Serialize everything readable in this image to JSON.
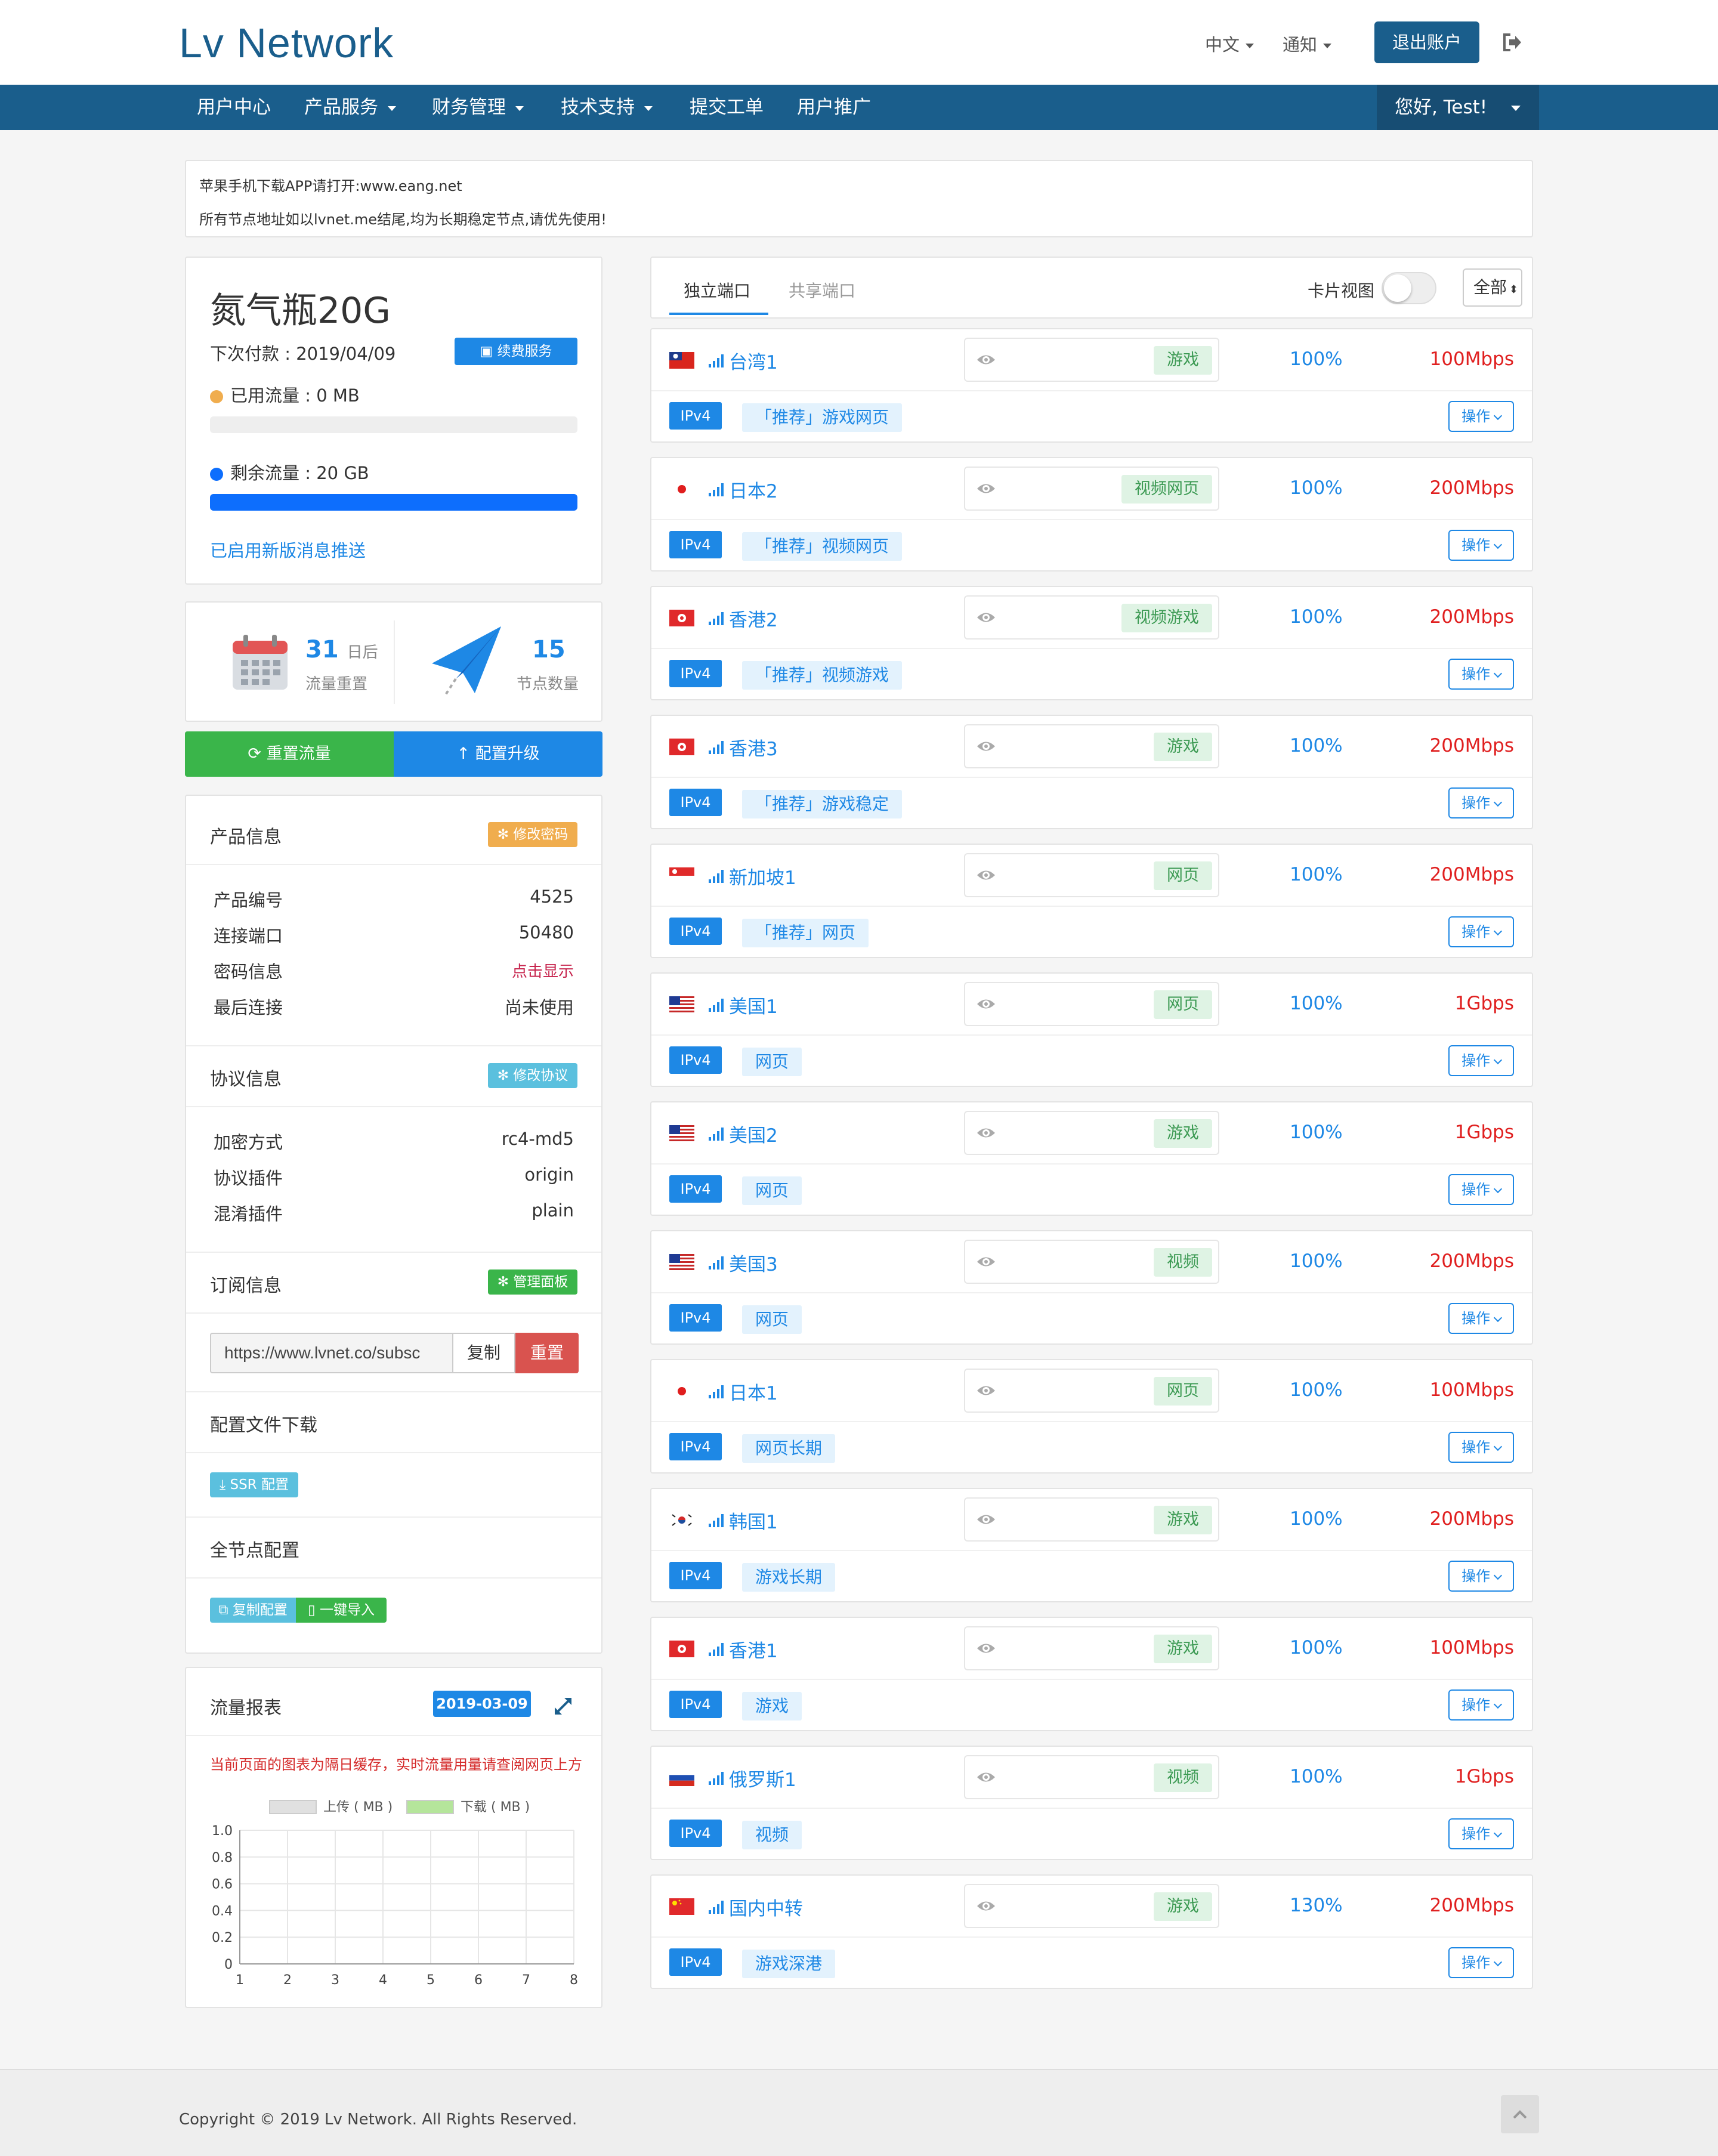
{
  "header": {
    "logo": "Lv Network",
    "lang_label": "中文",
    "notify_label": "通知",
    "logout_label": "退出账户"
  },
  "nav": {
    "items": [
      {
        "label": "用户中心",
        "dropdown": false
      },
      {
        "label": "产品服务",
        "dropdown": true
      },
      {
        "label": "财务管理",
        "dropdown": true
      },
      {
        "label": "技术支持",
        "dropdown": true
      },
      {
        "label": "提交工单",
        "dropdown": false
      },
      {
        "label": "用户推广",
        "dropdown": false
      }
    ],
    "user_label": "您好, Test!"
  },
  "notice": {
    "line1": "苹果手机下载APP请打开:www.eang.net",
    "line2": "所有节点地址如以lvnet.me结尾,均为长期稳定节点,请优先使用!"
  },
  "plan": {
    "name": "氮气瓶20G",
    "next_payment": "下次付款 : 2019/04/09",
    "renew_label": "续费服务",
    "used_label": "已用流量 : 0 MB",
    "remaining_label": "剩余流量 : 20 GB",
    "used_fraction": 0,
    "remaining_fraction": 1,
    "push_link": "已启用新版消息推送"
  },
  "stats": {
    "reset_days": "31",
    "reset_days_unit": "日后",
    "reset_caption": "流量重置",
    "node_count": "15",
    "node_caption": "节点数量"
  },
  "actions": {
    "reset_traffic": "重置流量",
    "upgrade": "配置升级"
  },
  "product_info": {
    "title": "产品信息",
    "change_pwd_label": "修改密码",
    "rows": [
      {
        "label": "产品编号",
        "value": "4525"
      },
      {
        "label": "连接端口",
        "value": "50480"
      },
      {
        "label": "密码信息",
        "value": "点击显示"
      },
      {
        "label": "最后连接",
        "value": "尚未使用"
      }
    ]
  },
  "protocol_info": {
    "title": "协议信息",
    "change_label": "修改协议",
    "rows": [
      {
        "label": "加密方式",
        "value": "rc4-md5"
      },
      {
        "label": "协议插件",
        "value": "origin"
      },
      {
        "label": "混淆插件",
        "value": "plain"
      }
    ]
  },
  "subscription": {
    "title": "订阅信息",
    "manage_label": "管理面板",
    "url_value": "https://www.lvnet.co/subsc",
    "copy_label": "复制",
    "reset_label": "重置"
  },
  "config_download": {
    "title": "配置文件下载",
    "ssr_label": "SSR 配置"
  },
  "all_nodes": {
    "title": "全节点配置",
    "copy_label": "复制配置",
    "import_label": "一键导入"
  },
  "traffic_report": {
    "title": "流量报表",
    "date": "2019-03-09",
    "note": "当前页面的图表为隔日缓存，实时流量用量请查阅网页上方"
  },
  "chart_data": {
    "type": "line",
    "title": "",
    "x": [
      1,
      2,
      3,
      4,
      5,
      6,
      7,
      8
    ],
    "series": [
      {
        "name": "上传 ( MB )",
        "values": [],
        "color": "#e0e0e0"
      },
      {
        "name": "下载 ( MB )",
        "values": [],
        "color": "#b5e59b"
      }
    ],
    "ylim": [
      0,
      1.0
    ],
    "yticks": [
      "1.0",
      "0.8",
      "0.6",
      "0.4",
      "0.2",
      "0"
    ],
    "xticks": [
      "1",
      "2",
      "3",
      "4",
      "5",
      "6",
      "7",
      "8"
    ],
    "grid": true,
    "legend_position": "top"
  },
  "nodes_panel": {
    "tab_dedicated": "独立端口",
    "tab_shared": "共享端口",
    "card_view_label": "卡片视图",
    "filter_label": "全部"
  },
  "nodes": [
    {
      "flag": "tw",
      "name": "台湾1",
      "tag": "游戏",
      "load": "100%",
      "speed": "100Mbps",
      "ip": "IPv4",
      "desc": "「推荐」游戏网页",
      "op": "操作"
    },
    {
      "flag": "jp",
      "name": "日本2",
      "tag": "视频网页",
      "load": "100%",
      "speed": "200Mbps",
      "ip": "IPv4",
      "desc": "「推荐」视频网页",
      "op": "操作"
    },
    {
      "flag": "hk",
      "name": "香港2",
      "tag": "视频游戏",
      "load": "100%",
      "speed": "200Mbps",
      "ip": "IPv4",
      "desc": "「推荐」视频游戏",
      "op": "操作"
    },
    {
      "flag": "hk",
      "name": "香港3",
      "tag": "游戏",
      "load": "100%",
      "speed": "200Mbps",
      "ip": "IPv4",
      "desc": "「推荐」游戏稳定",
      "op": "操作"
    },
    {
      "flag": "sg",
      "name": "新加坡1",
      "tag": "网页",
      "load": "100%",
      "speed": "200Mbps",
      "ip": "IPv4",
      "desc": "「推荐」网页",
      "op": "操作"
    },
    {
      "flag": "us",
      "name": "美国1",
      "tag": "网页",
      "load": "100%",
      "speed": "1Gbps",
      "ip": "IPv4",
      "desc": "网页",
      "op": "操作"
    },
    {
      "flag": "us",
      "name": "美国2",
      "tag": "游戏",
      "load": "100%",
      "speed": "1Gbps",
      "ip": "IPv4",
      "desc": "网页",
      "op": "操作"
    },
    {
      "flag": "us",
      "name": "美国3",
      "tag": "视频",
      "load": "100%",
      "speed": "200Mbps",
      "ip": "IPv4",
      "desc": "网页",
      "op": "操作"
    },
    {
      "flag": "jp",
      "name": "日本1",
      "tag": "网页",
      "load": "100%",
      "speed": "100Mbps",
      "ip": "IPv4",
      "desc": "网页长期",
      "op": "操作"
    },
    {
      "flag": "kr",
      "name": "韩国1",
      "tag": "游戏",
      "load": "100%",
      "speed": "200Mbps",
      "ip": "IPv4",
      "desc": "游戏长期",
      "op": "操作"
    },
    {
      "flag": "hk",
      "name": "香港1",
      "tag": "游戏",
      "load": "100%",
      "speed": "100Mbps",
      "ip": "IPv4",
      "desc": "游戏",
      "op": "操作"
    },
    {
      "flag": "ru",
      "name": "俄罗斯1",
      "tag": "视频",
      "load": "100%",
      "speed": "1Gbps",
      "ip": "IPv4",
      "desc": "视频",
      "op": "操作"
    },
    {
      "flag": "cn",
      "name": "国内中转",
      "tag": "游戏",
      "load": "130%",
      "speed": "200Mbps",
      "ip": "IPv4",
      "desc": "游戏深港",
      "op": "操作"
    }
  ],
  "footer": {
    "copyright": "Copyright © 2019 Lv Network. All Rights Reserved."
  },
  "colors": {
    "brand": "#1a5e8c",
    "accent_blue": "#1e88e5",
    "success": "#3ab54a",
    "danger": "#d9534f",
    "warning": "#f0ad4e",
    "info": "#5bc0de"
  }
}
